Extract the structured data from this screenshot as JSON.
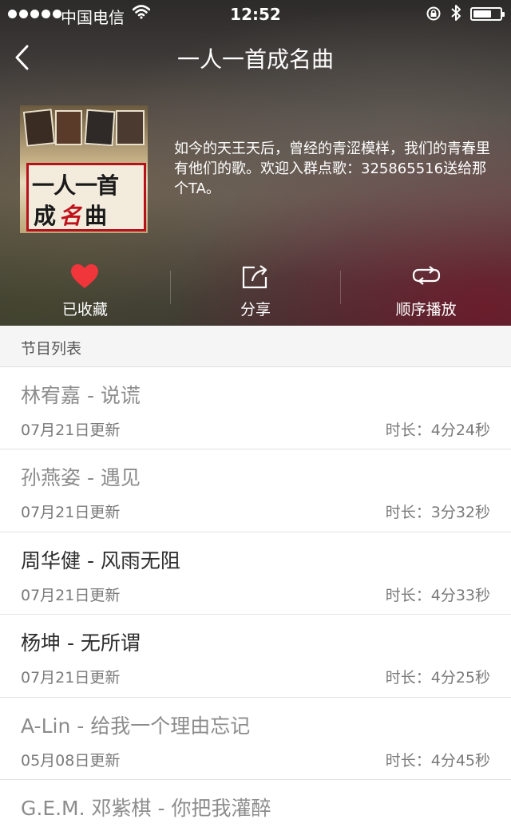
{
  "status_bar": {
    "carrier": "中国电信",
    "time": "12:52"
  },
  "nav": {
    "title": "一人一首成名曲"
  },
  "album": {
    "cover_line1": "一人一首",
    "cover_line2_a": "成",
    "cover_line2_b": "名",
    "cover_line2_c": "曲",
    "description": "如今的天王天后，曾经的青涩模样，我们的青春里有他们的歌。欢迎入群点歌：325865516送给那个TA。"
  },
  "actions": [
    {
      "label": "已收藏",
      "icon": "heart-icon"
    },
    {
      "label": "分享",
      "icon": "share-icon"
    },
    {
      "label": "顺序播放",
      "icon": "repeat-icon"
    }
  ],
  "section": {
    "title": "节目列表"
  },
  "programs": [
    {
      "title": "林宥嘉 - 说谎",
      "date": "07月21日更新",
      "duration": "时长：4分24秒"
    },
    {
      "title": "孙燕姿 - 遇见",
      "date": "07月21日更新",
      "duration": "时长：3分32秒"
    },
    {
      "title": "周华健 - 风雨无阻",
      "date": "07月21日更新",
      "duration": "时长：4分33秒"
    },
    {
      "title": "杨坤 - 无所谓",
      "date": "07月21日更新",
      "duration": "时长：4分25秒"
    },
    {
      "title": "A-Lin - 给我一个理由忘记",
      "date": "05月08日更新",
      "duration": "时长：4分45秒"
    },
    {
      "title": "G.E.M. 邓紫棋 - 你把我灌醉",
      "date": "",
      "duration": ""
    }
  ],
  "colors": {
    "heart": "#f0353b",
    "list_title_played": "#8c8c8c",
    "list_title_unplayed": "#2c2c2c"
  }
}
